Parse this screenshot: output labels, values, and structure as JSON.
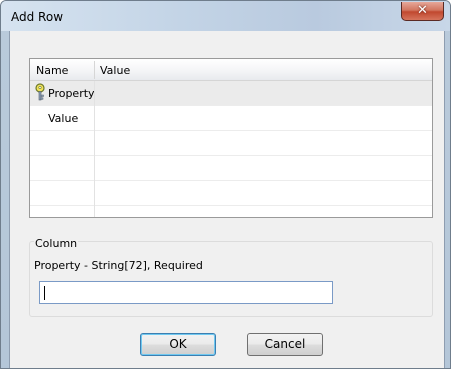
{
  "window": {
    "title": "Add Row"
  },
  "icons": {
    "close": "close-icon",
    "key": "key-icon"
  },
  "colors": {
    "close_button": "#c75a42",
    "selected_row": "#ebebeb",
    "input_border": "#7a9ac6"
  },
  "grid": {
    "columns": [
      "Name",
      "Value"
    ],
    "rows": [
      {
        "name": "Property",
        "value": "",
        "selected": true,
        "icon": "key-icon"
      },
      {
        "name": "Value",
        "value": "",
        "selected": false
      }
    ]
  },
  "column_group": {
    "title": "Column",
    "description": "Property - String[72], Required",
    "input_value": ""
  },
  "buttons": {
    "ok": "OK",
    "cancel": "Cancel"
  }
}
